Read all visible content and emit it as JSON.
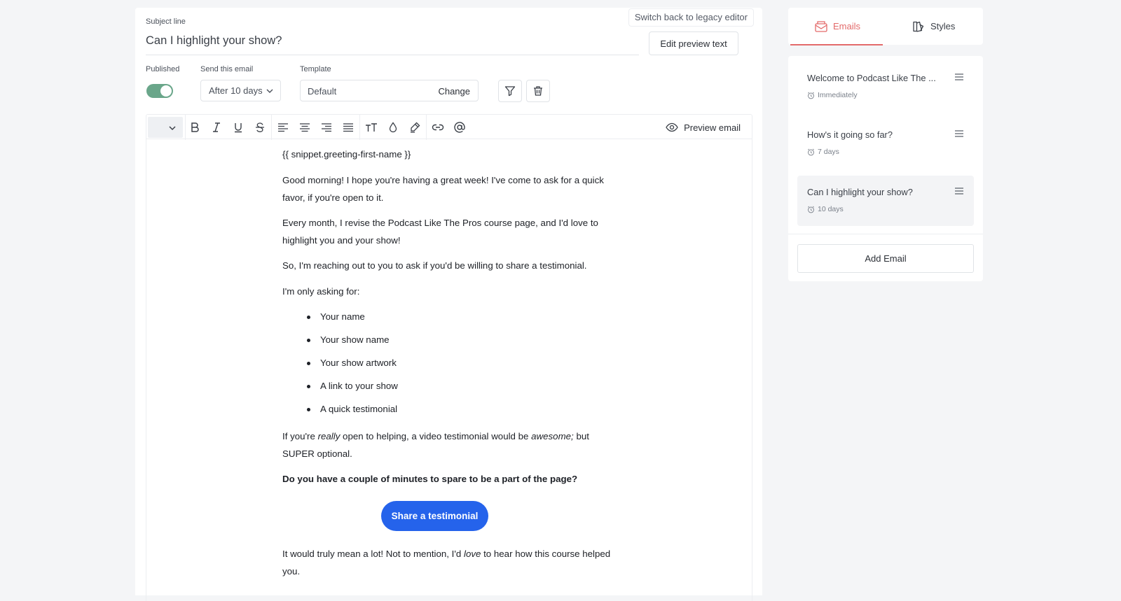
{
  "header": {
    "legacy_link": "Switch back to legacy editor",
    "subject_label": "Subject line",
    "subject_value": "Can I highlight your show?",
    "edit_preview_label": "Edit preview text"
  },
  "settings": {
    "published_label": "Published",
    "published_on": true,
    "send_label": "Send this email",
    "send_value": "After 10 days",
    "template_label": "Template",
    "template_value": "Default",
    "template_change": "Change"
  },
  "toolbar": {
    "preview_label": "Preview email"
  },
  "email": {
    "greeting": "{{ snippet.greeting-first-name }}",
    "p1": "Good morning!  I hope you're having a great week! I've come to ask for a quick favor, if you're open to it.",
    "p2": "Every month, I revise the Podcast Like The Pros course page, and I'd love to highlight you and your show!",
    "p3": "So, I'm reaching out to you to ask if you'd be willing to share a testimonial.",
    "p4": "I'm only asking for:",
    "list": [
      "Your name",
      "Your show name",
      "Your show artwork",
      "A link to your show",
      "A quick testimonial"
    ],
    "p5_a": "If you're ",
    "p5_b": "really",
    "p5_c": " open to helping, a video testimonial would be ",
    "p5_d": "awesome;",
    "p5_e": " but SUPER optional.",
    "p6": "Do you have a couple of minutes to spare to be a part of the page?",
    "cta": "Share a testimonial",
    "p7_a": "It would truly mean a lot! Not to mention, I'd ",
    "p7_b": "love",
    "p7_c": " to hear how this course helped you."
  },
  "sidebar": {
    "tabs": [
      {
        "label": "Emails",
        "icon": "envelope-icon",
        "active": true
      },
      {
        "label": "Styles",
        "icon": "paint-icon",
        "active": false
      }
    ],
    "emails": [
      {
        "title": "Welcome to Podcast Like The ...",
        "delay": "Immediately"
      },
      {
        "title": "How's it going so far?",
        "delay": "7 days"
      },
      {
        "title": "Can I highlight your show?",
        "delay": "10 days"
      }
    ],
    "add_label": "Add Email"
  },
  "colors": {
    "accent": "#e36a6a",
    "toggle": "#6aa68a",
    "cta": "#2563eb"
  }
}
